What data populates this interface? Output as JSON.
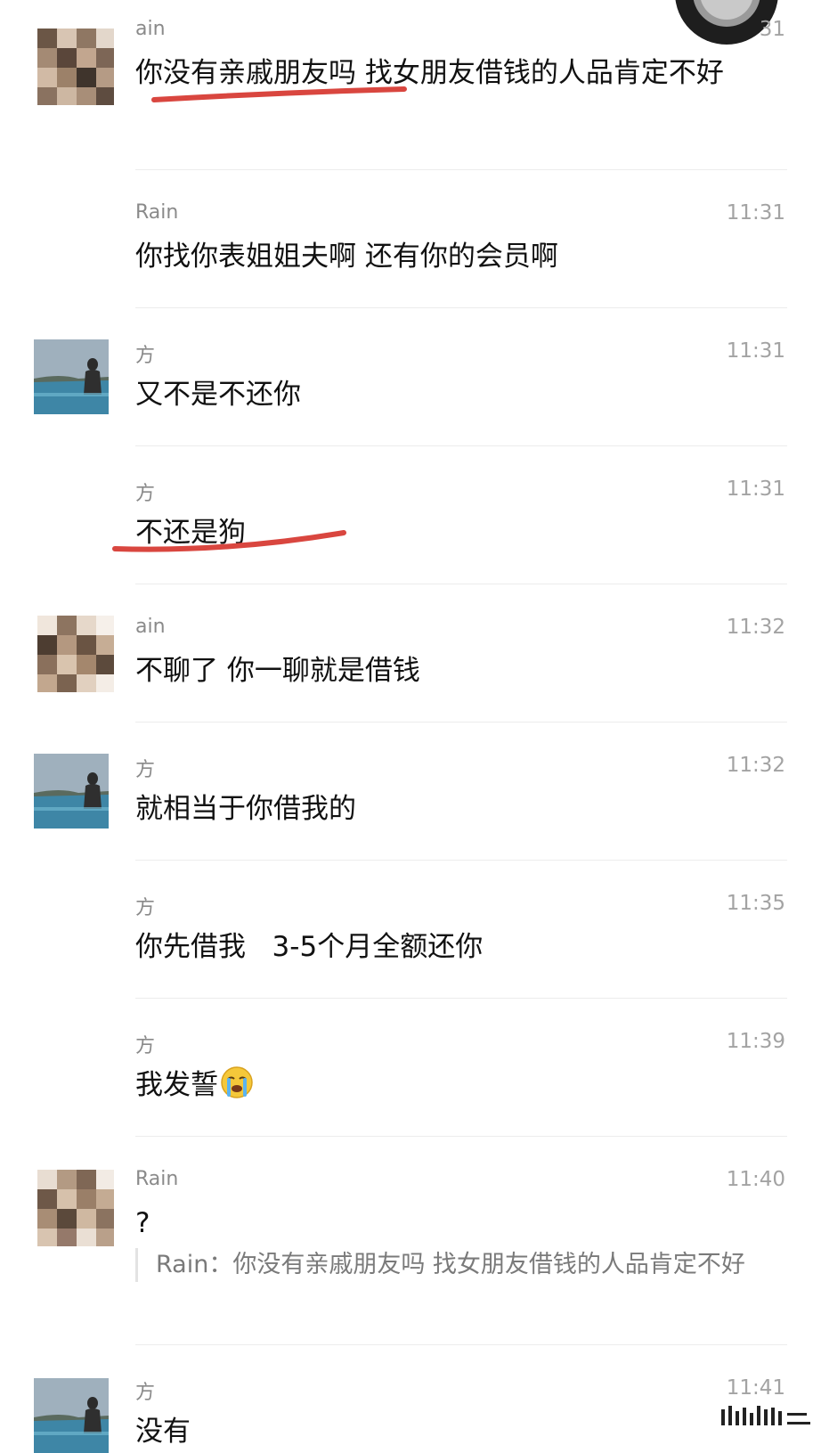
{
  "messages": [
    {
      "sender": "ain",
      "time": "31",
      "text": "你没有亲戚朋友吗 找女朋友借钱的人品肯定不好"
    },
    {
      "sender": "Rain",
      "time": "11:31",
      "text": "你找你表姐姐夫啊 还有你的会员啊"
    },
    {
      "sender": "方",
      "time": "11:31",
      "text": "又不是不还你"
    },
    {
      "sender": "方",
      "time": "11:31",
      "text": "不还是狗"
    },
    {
      "sender": "ain",
      "time": "11:32",
      "text": "不聊了 你一聊就是借钱"
    },
    {
      "sender": "方",
      "time": "11:32",
      "text": "就相当于你借我的"
    },
    {
      "sender": "方",
      "time": "11:35",
      "text": "你先借我   3-5个月全额还你"
    },
    {
      "sender": "方",
      "time": "11:39",
      "text": "我发誓",
      "emoji": "crying-emoji"
    },
    {
      "sender": "Rain",
      "time": "11:40",
      "text": "?",
      "quote": "Rain：你没有亲戚朋友吗 找女朋友借钱的人品肯定不好"
    },
    {
      "sender": "方",
      "time": "11:41",
      "text": "没有"
    }
  ],
  "colors": {
    "highlight": "#d9463f",
    "separator": "#ececec",
    "muted_text": "#8a8a8a"
  }
}
